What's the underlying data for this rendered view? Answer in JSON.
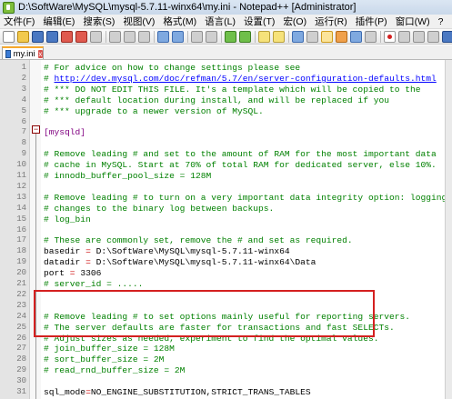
{
  "window": {
    "title": "D:\\SoftWare\\MySQL\\mysql-5.7.11-winx64\\my.ini - Notepad++ [Administrator]"
  },
  "menu": {
    "items": [
      "文件(F)",
      "编辑(E)",
      "搜索(S)",
      "视图(V)",
      "格式(M)",
      "语言(L)",
      "设置(T)",
      "宏(O)",
      "运行(R)",
      "插件(P)",
      "窗口(W)",
      "?"
    ],
    "close_label": "X"
  },
  "tab": {
    "label": "my.ini",
    "close_label": "x"
  },
  "editor": {
    "lines": [
      {
        "num": "1",
        "text": "# For advice on how to change settings please see",
        "kind": "comment"
      },
      {
        "num": "2",
        "text": "# http://dev.mysql.com/doc/refman/5.7/en/server-configuration-defaults.html",
        "kind": "url"
      },
      {
        "num": "3",
        "text": "# *** DO NOT EDIT THIS FILE. It's a template which will be copied to the",
        "kind": "comment"
      },
      {
        "num": "4",
        "text": "# *** default location during install, and will be replaced if you",
        "kind": "comment"
      },
      {
        "num": "5",
        "text": "# *** upgrade to a newer version of MySQL.",
        "kind": "comment"
      },
      {
        "num": "6",
        "text": "",
        "kind": "blank"
      },
      {
        "num": "7",
        "text": "[mysqld]",
        "kind": "section"
      },
      {
        "num": "8",
        "text": "",
        "kind": "blank"
      },
      {
        "num": "9",
        "text": "# Remove leading # and set to the amount of RAM for the most important data",
        "kind": "comment"
      },
      {
        "num": "10",
        "text": "# cache in MySQL. Start at 70% of total RAM for dedicated server, else 10%.",
        "kind": "comment"
      },
      {
        "num": "11",
        "text": "# innodb_buffer_pool_size = 128M",
        "kind": "comment"
      },
      {
        "num": "12",
        "text": "",
        "kind": "blank"
      },
      {
        "num": "13",
        "text": "# Remove leading # to turn on a very important data integrity option: logging",
        "kind": "comment"
      },
      {
        "num": "14",
        "text": "# changes to the binary log between backups.",
        "kind": "comment"
      },
      {
        "num": "15",
        "text": "# log_bin",
        "kind": "comment"
      },
      {
        "num": "16",
        "text": "",
        "kind": "blank"
      },
      {
        "num": "17",
        "text": "# These are commonly set, remove the # and set as required.",
        "kind": "comment"
      },
      {
        "num": "18",
        "key": "basedir",
        "op": " = ",
        "value": "D:\\SoftWare\\MySQL\\mysql-5.7.11-winx64",
        "kind": "kv"
      },
      {
        "num": "19",
        "key": "datadir",
        "op": " = ",
        "value": "D:\\SoftWare\\MySQL\\mysql-5.7.11-winx64\\Data",
        "kind": "kv"
      },
      {
        "num": "20",
        "key": "port",
        "op": " = ",
        "value": "3306",
        "kind": "kv"
      },
      {
        "num": "21",
        "text": "# server_id = .....",
        "kind": "comment"
      },
      {
        "num": "22",
        "text": "",
        "kind": "blank"
      },
      {
        "num": "23",
        "text": "",
        "kind": "blank"
      },
      {
        "num": "24",
        "text": "# Remove leading # to set options mainly useful for reporting servers.",
        "kind": "comment"
      },
      {
        "num": "25",
        "text": "# The server defaults are faster for transactions and fast SELECTs.",
        "kind": "comment"
      },
      {
        "num": "26",
        "text": "# Adjust sizes as needed, experiment to find the optimal values.",
        "kind": "comment"
      },
      {
        "num": "27",
        "text": "# join_buffer_size = 128M",
        "kind": "comment"
      },
      {
        "num": "28",
        "text": "# sort_buffer_size = 2M",
        "kind": "comment"
      },
      {
        "num": "29",
        "text": "# read_rnd_buffer_size = 2M",
        "kind": "comment"
      },
      {
        "num": "30",
        "text": "",
        "kind": "blank"
      },
      {
        "num": "31",
        "key": "sql_mode",
        "op": "=",
        "value": "NO_ENGINE_SUBSTITUTION,STRICT_TRANS_TABLES",
        "kind": "kv"
      }
    ]
  },
  "colors": {
    "comment": "#008000",
    "section": "#800080",
    "operator": "#cc0000",
    "highlight_box": "#d42020",
    "tab_accent": "#f7a82b"
  }
}
